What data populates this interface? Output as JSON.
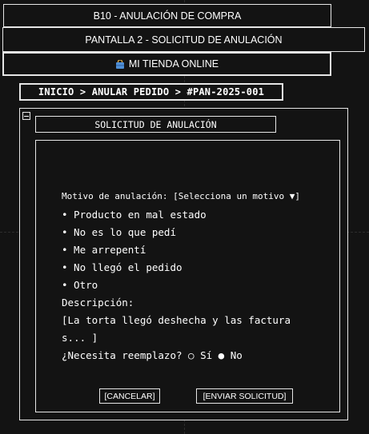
{
  "header": {
    "screen_code": "B10 - ANULACIÓN DE COMPRA",
    "screen_name": "PANTALLA 2 - SOLICITUD DE ANULACIÓN",
    "store_name": "MI TIENDA ONLINE",
    "store_icon": "shopping-bag-icon"
  },
  "breadcrumb": {
    "text": "INICIO > ANULAR PEDIDO > #PAN-2025-001"
  },
  "panel": {
    "title": "SOLICITUD DE ANULACIÓN",
    "minimize_icon": "minimize-icon"
  },
  "form": {
    "reason_label": "Motivo de anulación: [Selecciona un motivo ▼]",
    "reasons": [
      "• Producto en mal estado",
      "• No es lo que pedí",
      "• Me arrepentí",
      "• No llegó el pedido",
      "• Otro"
    ],
    "description_label": "Descripción:",
    "description_line1": "[La torta llegó deshecha y las factura",
    "description_line2": "s... ]",
    "replacement_question": "¿Necesita reemplazo? ○ Sí ● No"
  },
  "buttons": {
    "cancel": "[CANCELAR]",
    "submit": "[ENVIAR SOLICITUD]"
  }
}
